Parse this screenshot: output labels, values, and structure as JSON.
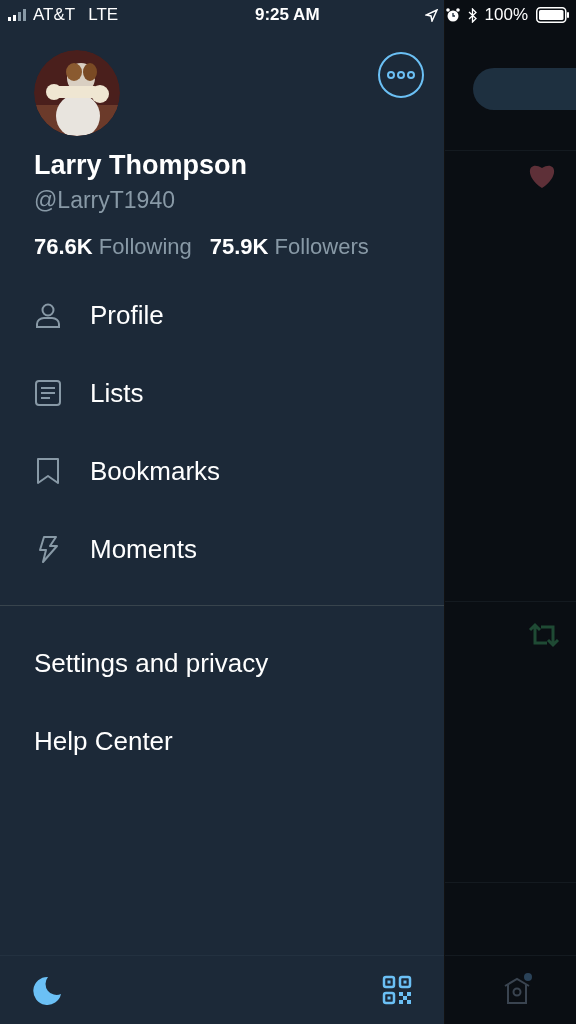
{
  "status_bar": {
    "carrier": "AT&T",
    "network": "LTE",
    "time": "9:25 AM",
    "battery": "100%"
  },
  "profile": {
    "name": "Larry Thompson",
    "handle": "@LarryT1940",
    "following_count": "76.6K",
    "following_label": "Following",
    "followers_count": "75.9K",
    "followers_label": "Followers"
  },
  "menu": [
    {
      "label": "Profile",
      "kind": "profile"
    },
    {
      "label": "Lists",
      "kind": "lists"
    },
    {
      "label": "Bookmarks",
      "kind": "bookmarks"
    },
    {
      "label": "Moments",
      "kind": "moments"
    }
  ],
  "secondary_menu": [
    {
      "label": "Settings and privacy"
    },
    {
      "label": "Help Center"
    }
  ]
}
